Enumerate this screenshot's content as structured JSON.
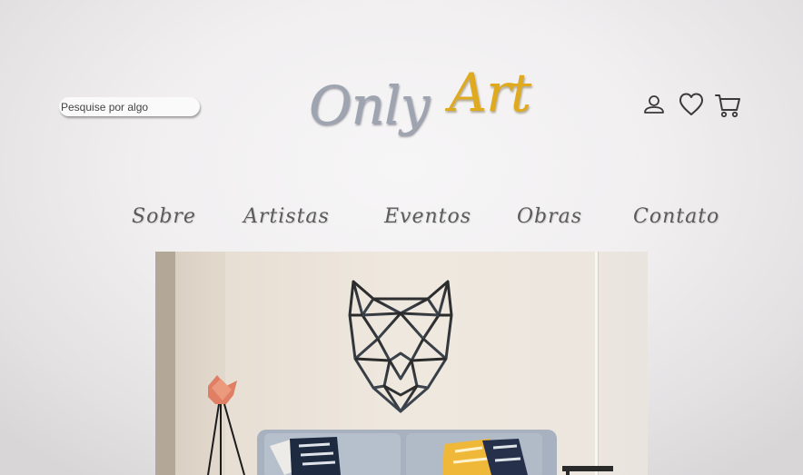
{
  "search": {
    "placeholder": "Pesquise por algo"
  },
  "logo": {
    "word1": "Only",
    "word2": "Art"
  },
  "header_icons": [
    "user-icon",
    "heart-icon",
    "cart-icon"
  ],
  "nav": [
    {
      "label": "Sobre"
    },
    {
      "label": "Artistas"
    },
    {
      "label": "Eventos"
    },
    {
      "label": "Obras"
    },
    {
      "label": "Contato"
    }
  ],
  "colors": {
    "logo_gray": "#9fa5b0",
    "logo_gold": "#e0aa1f",
    "nav_text": "#5b5b5b"
  }
}
